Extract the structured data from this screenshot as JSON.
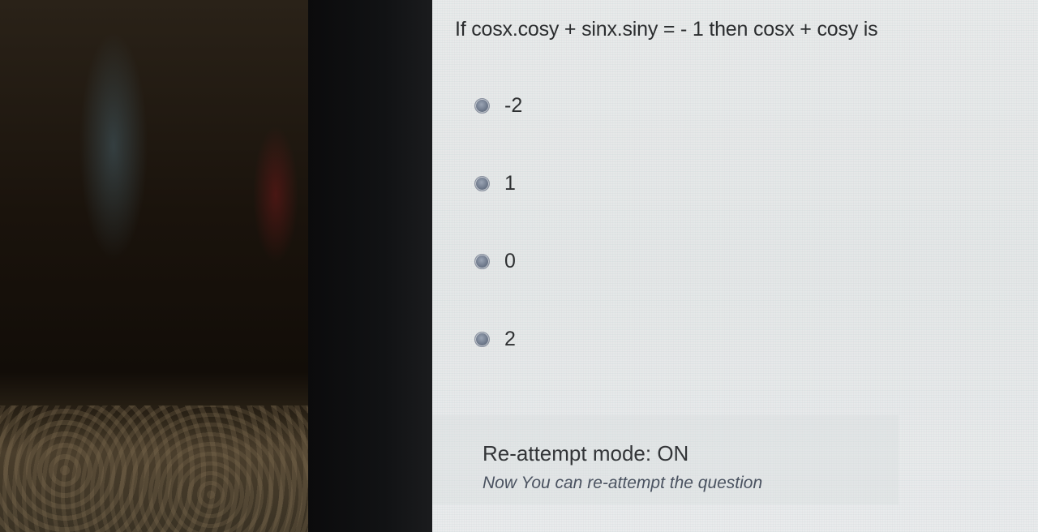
{
  "question": {
    "text": "If cosx.cosy + sinx.siny = - 1 then cosx + cosy is"
  },
  "options": [
    {
      "label": "-2"
    },
    {
      "label": "1"
    },
    {
      "label": "0"
    },
    {
      "label": "2"
    }
  ],
  "footer": {
    "mode_text": "Re-attempt mode: ON",
    "hint_text": "Now You can re-attempt the question"
  }
}
